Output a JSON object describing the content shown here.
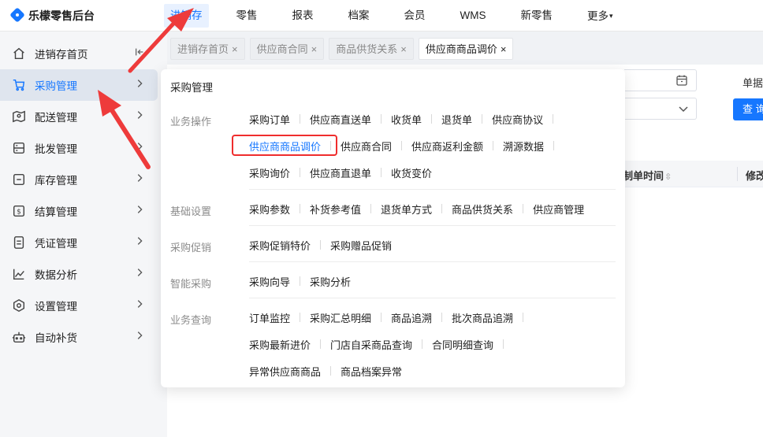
{
  "app": {
    "title": "乐檬零售后台"
  },
  "topnav": {
    "items": [
      {
        "label": "进销存",
        "active": true
      },
      {
        "label": "零售"
      },
      {
        "label": "报表"
      },
      {
        "label": "档案"
      },
      {
        "label": "会员"
      },
      {
        "label": "WMS"
      },
      {
        "label": "新零售"
      },
      {
        "label": "更多",
        "caret": "▾"
      }
    ]
  },
  "sidebar": {
    "items": [
      {
        "label": "进销存首页",
        "icon": "home-icon"
      },
      {
        "label": "采购管理",
        "icon": "cart-icon",
        "active": true
      },
      {
        "label": "配送管理",
        "icon": "map-icon"
      },
      {
        "label": "批发管理",
        "icon": "storage-icon"
      },
      {
        "label": "库存管理",
        "icon": "box-icon"
      },
      {
        "label": "结算管理",
        "icon": "dollar-icon"
      },
      {
        "label": "凭证管理",
        "icon": "document-icon"
      },
      {
        "label": "数据分析",
        "icon": "chart-icon"
      },
      {
        "label": "设置管理",
        "icon": "gear-icon"
      },
      {
        "label": "自动补货",
        "icon": "robot-icon"
      }
    ]
  },
  "tabs": [
    {
      "label": "进销存首页"
    },
    {
      "label": "供应商合同"
    },
    {
      "label": "商品供货关系"
    },
    {
      "label": "供应商商品调价",
      "active": true
    }
  ],
  "close_glyph": "×",
  "content": {
    "doc_label": "单据",
    "query_button": "查 询",
    "table_headers": [
      "制单时间",
      "修改"
    ]
  },
  "menu": {
    "title": "采购管理",
    "groups": [
      {
        "label": "业务操作",
        "rows": [
          [
            "采购订单",
            "供应商直送单",
            "收货单",
            "退货单",
            "供应商协议"
          ],
          [
            "供应商商品调价",
            "供应商合同",
            "供应商返利金额",
            "溯源数据"
          ],
          [
            "采购询价",
            "供应商直退单",
            "收货变价"
          ]
        ]
      },
      {
        "label": "基础设置",
        "rows": [
          [
            "采购参数",
            "补货参考值",
            "退货单方式",
            "商品供货关系",
            "供应商管理"
          ]
        ]
      },
      {
        "label": "采购促销",
        "rows": [
          [
            "采购促销特价",
            "采购赠品促销"
          ]
        ]
      },
      {
        "label": "智能采购",
        "rows": [
          [
            "采购向导",
            "采购分析"
          ]
        ]
      },
      {
        "label": "业务查询",
        "rows": [
          [
            "订单监控",
            "采购汇总明细",
            "商品追溯",
            "批次商品追溯"
          ],
          [
            "采购最新进价",
            "门店自采商品查询",
            "合同明细查询"
          ],
          [
            "异常供应商商品",
            "商品档案异常"
          ]
        ]
      }
    ],
    "highlighted_item": "供应商商品调价"
  },
  "colors": {
    "accent": "#1677ff",
    "highlight_box": "#ef2d2d",
    "arrow": "#ee3b3b"
  }
}
